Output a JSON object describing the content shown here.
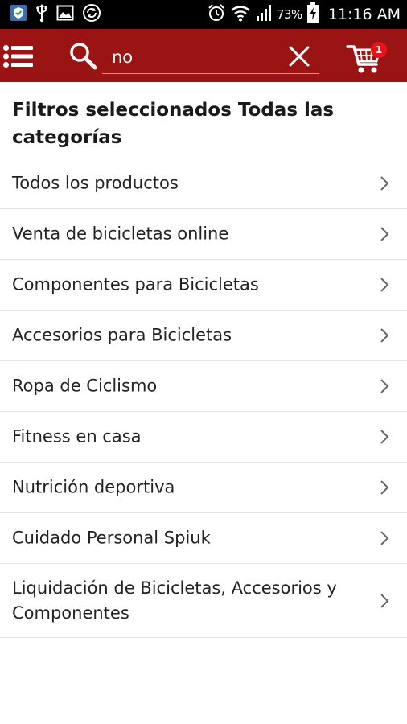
{
  "status_bar": {
    "battery": "73%",
    "time": "11:16 AM",
    "icons": [
      "shield-notification-icon",
      "usb-icon",
      "image-icon",
      "sync-icon",
      "alarm-icon",
      "wifi-icon",
      "signal-icon",
      "battery-charging-icon"
    ]
  },
  "toolbar": {
    "menu_icon": "list-menu-icon",
    "search_icon": "search-icon",
    "search_value": "no",
    "clear_icon": "close-icon",
    "cart_icon": "shopping-cart-icon",
    "cart_count": "1"
  },
  "filters": {
    "title": "Filtros seleccionados Todas las categorías"
  },
  "categories": [
    {
      "label": "Todos los productos"
    },
    {
      "label": "Venta de bicicletas online"
    },
    {
      "label": "Componentes para Bicicletas"
    },
    {
      "label": "Accesorios para Bicicletas"
    },
    {
      "label": "Ropa de Ciclismo"
    },
    {
      "label": "Fitness en casa"
    },
    {
      "label": "Nutrición deportiva"
    },
    {
      "label": "Cuidado Personal Spiuk"
    },
    {
      "label": "Liquidación de Bicicletas, Accesorios y Componentes"
    }
  ],
  "colors": {
    "appbar": "#9b1414",
    "badge": "#e8141c",
    "text": "#222222",
    "divider": "#e4e4e4"
  }
}
